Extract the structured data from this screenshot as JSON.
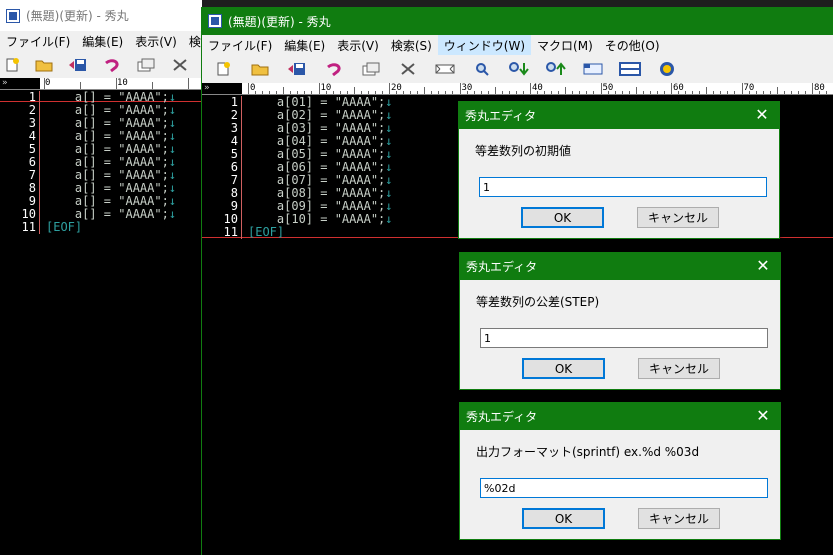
{
  "back_window": {
    "title": "(無題)(更新) - 秀丸",
    "menu": [
      "ファイル(F)",
      "編集(E)",
      "表示(V)",
      "検索"
    ],
    "ruler_corner": "»",
    "ruler_labels": [
      "0",
      "10"
    ],
    "lines": [
      {
        "n": "1",
        "code": "    a[] = \"AAAA\";",
        "ret": "↓"
      },
      {
        "n": "2",
        "code": "    a[] = \"AAAA\";",
        "ret": "↓"
      },
      {
        "n": "3",
        "code": "    a[] = \"AAAA\";",
        "ret": "↓"
      },
      {
        "n": "4",
        "code": "    a[] = \"AAAA\";",
        "ret": "↓"
      },
      {
        "n": "5",
        "code": "    a[] = \"AAAA\";",
        "ret": "↓"
      },
      {
        "n": "6",
        "code": "    a[] = \"AAAA\";",
        "ret": "↓"
      },
      {
        "n": "7",
        "code": "    a[] = \"AAAA\";",
        "ret": "↓"
      },
      {
        "n": "8",
        "code": "    a[] = \"AAAA\";",
        "ret": "↓"
      },
      {
        "n": "9",
        "code": "    a[] = \"AAAA\";",
        "ret": "↓"
      },
      {
        "n": "10",
        "code": "    a[] = \"AAAA\";",
        "ret": "↓"
      }
    ],
    "eof_line": {
      "n": "11",
      "text": "[EOF]"
    }
  },
  "front_window": {
    "title": "(無題)(更新) - 秀丸",
    "menu": [
      "ファイル(F)",
      "編集(E)",
      "表示(V)",
      "検索(S)",
      "ウィンドウ(W)",
      "マクロ(M)",
      "その他(O)"
    ],
    "ruler_corner": "»",
    "ruler_labels": [
      "0",
      "10",
      "20",
      "30",
      "40",
      "50",
      "60",
      "70",
      "80"
    ],
    "lines": [
      {
        "n": "1",
        "code": "    a[01] = \"AAAA\";",
        "ret": "↓"
      },
      {
        "n": "2",
        "code": "    a[02] = \"AAAA\";",
        "ret": "↓"
      },
      {
        "n": "3",
        "code": "    a[03] = \"AAAA\";",
        "ret": "↓"
      },
      {
        "n": "4",
        "code": "    a[04] = \"AAAA\";",
        "ret": "↓"
      },
      {
        "n": "5",
        "code": "    a[05] = \"AAAA\";",
        "ret": "↓"
      },
      {
        "n": "6",
        "code": "    a[06] = \"AAAA\";",
        "ret": "↓"
      },
      {
        "n": "7",
        "code": "    a[07] = \"AAAA\";",
        "ret": "↓"
      },
      {
        "n": "8",
        "code": "    a[08] = \"AAAA\";",
        "ret": "↓"
      },
      {
        "n": "9",
        "code": "    a[09] = \"AAAA\";",
        "ret": "↓"
      },
      {
        "n": "10",
        "code": "    a[10] = \"AAAA\";",
        "ret": "↓"
      }
    ],
    "eof_line": {
      "n": "11",
      "text": "[EOF]"
    }
  },
  "toolbar_icons": [
    "new-file-icon",
    "open-folder-icon",
    "save-icon",
    "undo-icon",
    "copy-icon",
    "cut-icon",
    "paste-icon",
    "search-icon",
    "search-down-icon",
    "search-up-icon",
    "window-icon",
    "split-icon",
    "help-icon"
  ],
  "dialogs": [
    {
      "title": "秀丸エディタ",
      "close": "✕",
      "label": "等差数列の初期値",
      "value": "1",
      "ok": "OK",
      "cancel": "キャンセル"
    },
    {
      "title": "秀丸エディタ",
      "close": "✕",
      "label": "等差数列の公差(STEP)",
      "value": "1",
      "ok": "OK",
      "cancel": "キャンセル"
    },
    {
      "title": "秀丸エディタ",
      "close": "✕",
      "label": "出力フォーマット(sprintf) ex.%d %03d",
      "value": "%02d",
      "ok": "OK",
      "cancel": "キャンセル"
    }
  ],
  "colors": {
    "titlebar_active": "#107c10",
    "editor_bg": "#000000",
    "text": "#c8d0c8",
    "return_mark": "#2ea0a0"
  }
}
